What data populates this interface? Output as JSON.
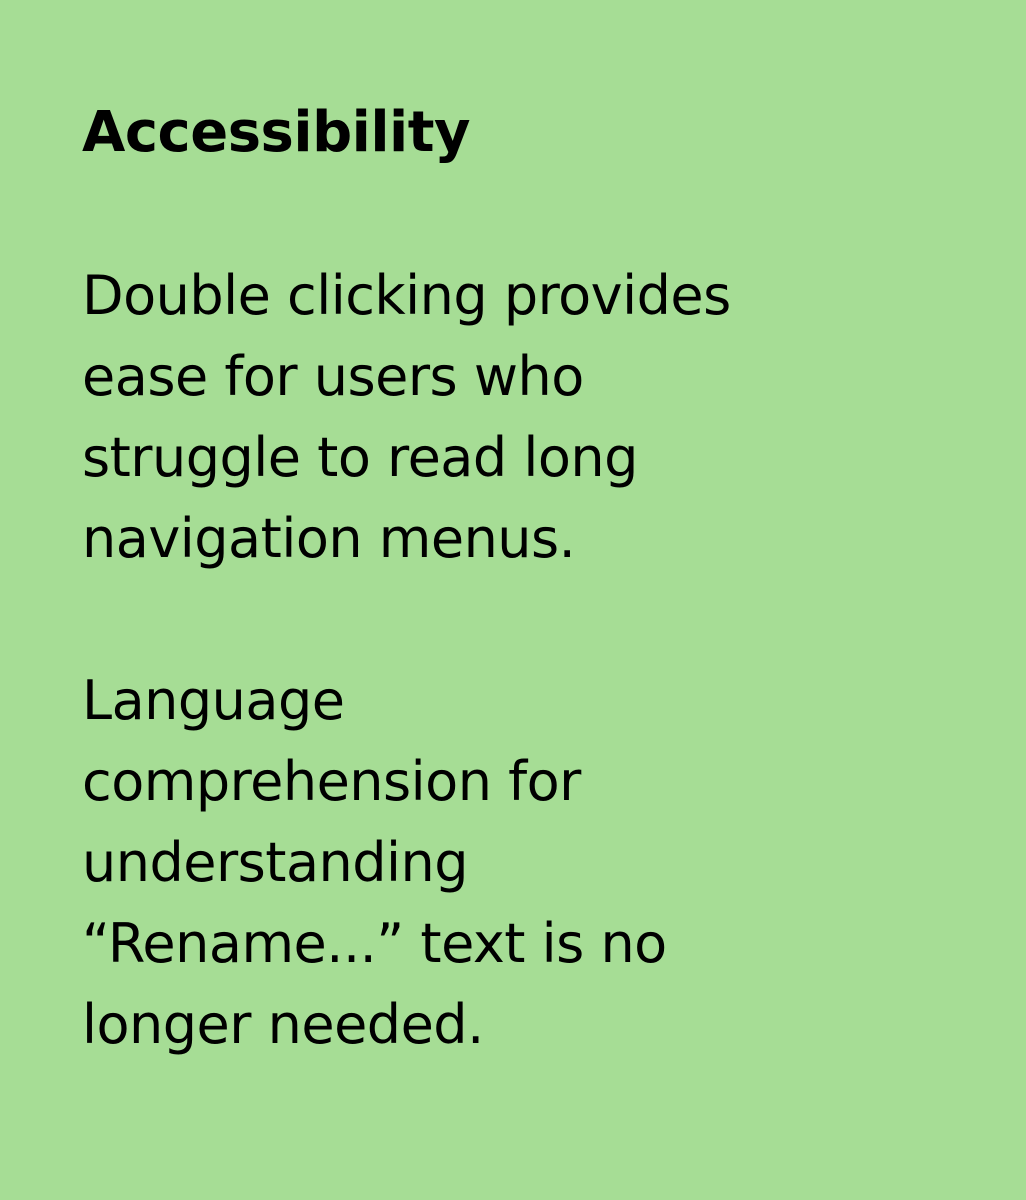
{
  "card": {
    "background_color": "#a6dd95",
    "text_color": "#000000",
    "heading": "Accessibility",
    "paragraph_1_lines": [
      "Double clicking provides",
      "ease for users who",
      "struggle to read long",
      "navigation menus."
    ],
    "paragraph_2_lines": [
      "Language",
      "comprehension for",
      "understanding",
      "“Rename...” text is no",
      "longer needed."
    ]
  }
}
